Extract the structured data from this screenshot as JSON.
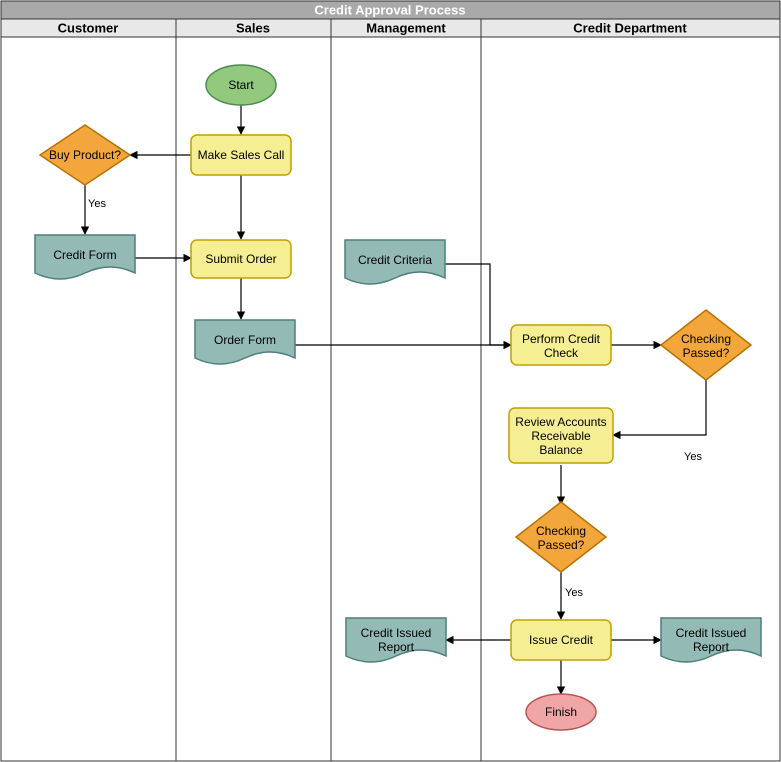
{
  "title": "Credit Approval Process",
  "lanes": {
    "customer": "Customer",
    "sales": "Sales",
    "management": "Management",
    "credit_dept": "Credit Department"
  },
  "nodes": {
    "start": "Start",
    "make_sales_call": "Make Sales Call",
    "buy_product": "Buy Product?",
    "credit_form": "Credit Form",
    "submit_order": "Submit Order",
    "order_form": "Order Form",
    "credit_criteria": "Credit Criteria",
    "perform_credit_check_l1": "Perform Credit",
    "perform_credit_check_l2": "Check",
    "checking_passed_1_l1": "Checking",
    "checking_passed_1_l2": "Passed?",
    "review_ar_l1": "Review Accounts",
    "review_ar_l2": "Receivable",
    "review_ar_l3": "Balance",
    "checking_passed_2_l1": "Checking",
    "checking_passed_2_l2": "Passed?",
    "issue_credit": "Issue Credit",
    "credit_issued_report_mgmt_l1": "Credit Issued",
    "credit_issued_report_mgmt_l2": "Report",
    "credit_issued_report_cd_l1": "Credit Issued",
    "credit_issued_report_cd_l2": "Report",
    "finish": "Finish"
  },
  "edge_labels": {
    "yes1": "Yes",
    "yes2": "Yes",
    "yes3": "Yes"
  }
}
